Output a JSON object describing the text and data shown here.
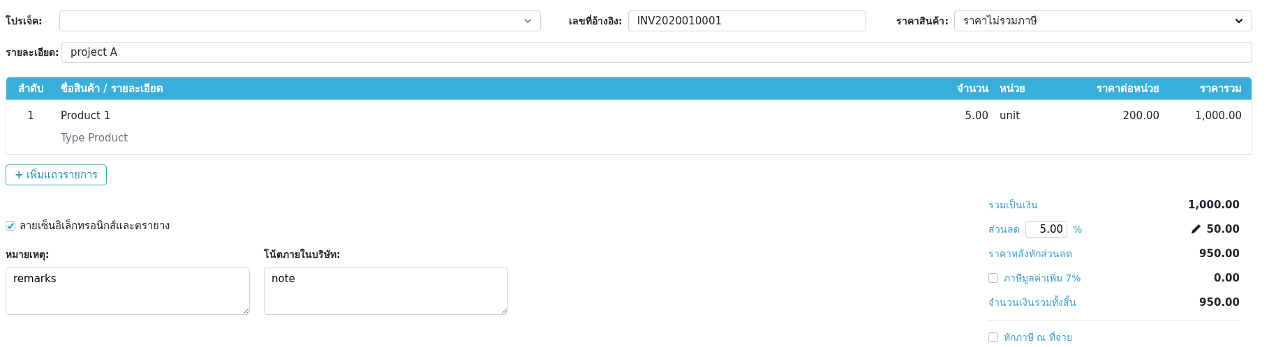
{
  "header": {
    "project": {
      "label": "โปรเจ็ค:"
    },
    "reference": {
      "label": "เลขที่อ้างอิง:",
      "value": "INV2020010001"
    },
    "price_type": {
      "label": "ราคาสินค้า:",
      "value": "ราคาไม่รวมภาษี"
    },
    "detail": {
      "label": "รายละเอียด:",
      "value": "project A"
    }
  },
  "table": {
    "columns": [
      "ลำดับ",
      "ชื่อสินค้า / รายละเอียด",
      "จำนวน",
      "หน่วย",
      "ราคาต่อหน่วย",
      "ราคารวม"
    ],
    "rows": [
      {
        "no": "1",
        "name": "Product 1",
        "type": "Type Product",
        "qty": "5.00",
        "unit": "unit",
        "price": "200.00",
        "total": "1,000.00"
      }
    ]
  },
  "add_row_button": {
    "icon": "+",
    "label": "เพิ่มแถวรายการ"
  },
  "signature": {
    "label": "ลายเซ็นอิเล็กทรอนิกส์และตรายาง",
    "checked": true
  },
  "remarks": {
    "label": "หมายเหตุ:",
    "value": "remarks"
  },
  "internal_note": {
    "label": "โน้ตภายในบริษัท:",
    "value": "note"
  },
  "summary": [
    {
      "kind": "plain",
      "label": "รวมเป็นเงิน",
      "value": "1,000.00"
    },
    {
      "kind": "discount",
      "label": "ส่วนลด",
      "input": "5.00",
      "unit": "%",
      "value": "50.00"
    },
    {
      "kind": "plain",
      "label": "ราคาหลังหักส่วนลด",
      "value": "950.00"
    },
    {
      "kind": "checkbox",
      "label": "ภาษีมูลค่าเพิ่ม 7%",
      "checked": false,
      "value": "0.00"
    },
    {
      "kind": "plain",
      "label": "จำนวนเงินรวมทั้งสิ้น",
      "value": "950.00"
    }
  ],
  "withholding": {
    "label": "หักภาษี ณ ที่จ่าย",
    "checked": false
  }
}
